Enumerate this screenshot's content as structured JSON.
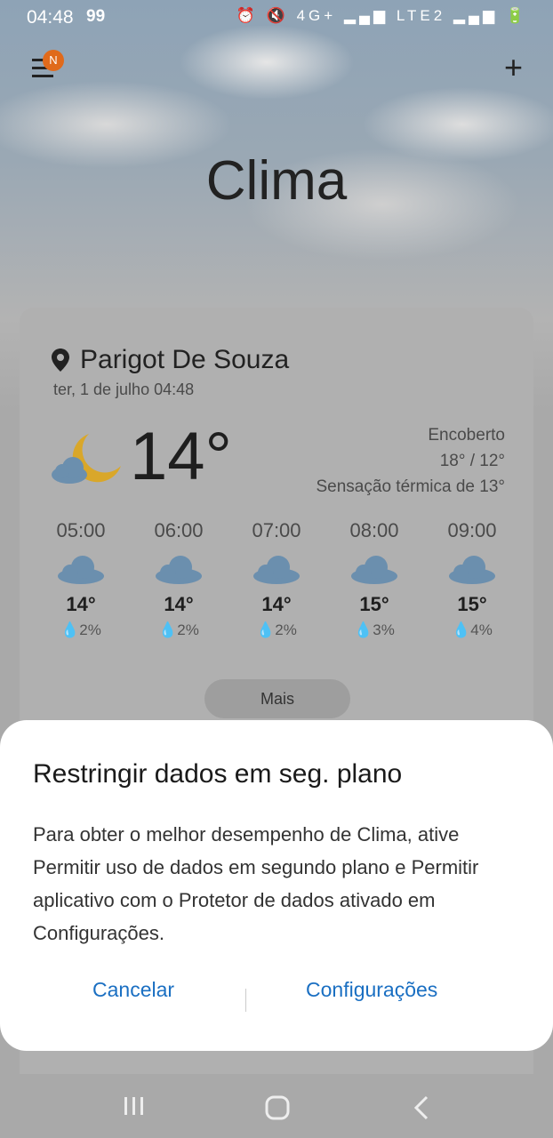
{
  "status_bar": {
    "time": "04:48",
    "left_icons": "99",
    "right_icons": "⏰ 🔇 4G+ ▂▄▆ LTE2 ▂▄▆ 🔋"
  },
  "app": {
    "title": "Clima",
    "notification_badge": "N"
  },
  "location": {
    "name": "Parigot De Souza",
    "date": "ter, 1 de julho 04:48"
  },
  "current": {
    "temp": "14°",
    "condition": "Encoberto",
    "high_low": "18° / 12°",
    "feels_like": "Sensação térmica de 13°"
  },
  "hourly": [
    {
      "hour": "05:00",
      "temp": "14°",
      "precip": "2%"
    },
    {
      "hour": "06:00",
      "temp": "14°",
      "precip": "2%"
    },
    {
      "hour": "07:00",
      "temp": "14°",
      "precip": "2%"
    },
    {
      "hour": "08:00",
      "temp": "15°",
      "precip": "3%"
    },
    {
      "hour": "09:00",
      "temp": "15°",
      "precip": "4%"
    }
  ],
  "more_label": "Mais",
  "dialog": {
    "title": "Restringir dados em seg. plano",
    "body": "Para obter o melhor desempenho de Clima, ative Permitir uso de dados em segundo plano e Permitir aplicativo com o Protetor de dados ativado em Configurações.",
    "cancel_label": "Cancelar",
    "settings_label": "Configurações"
  },
  "colors": {
    "accent": "#1a6fc2",
    "badge": "#e06a1b",
    "moon": "#d9a72a",
    "cloud": "#6b8fae"
  }
}
